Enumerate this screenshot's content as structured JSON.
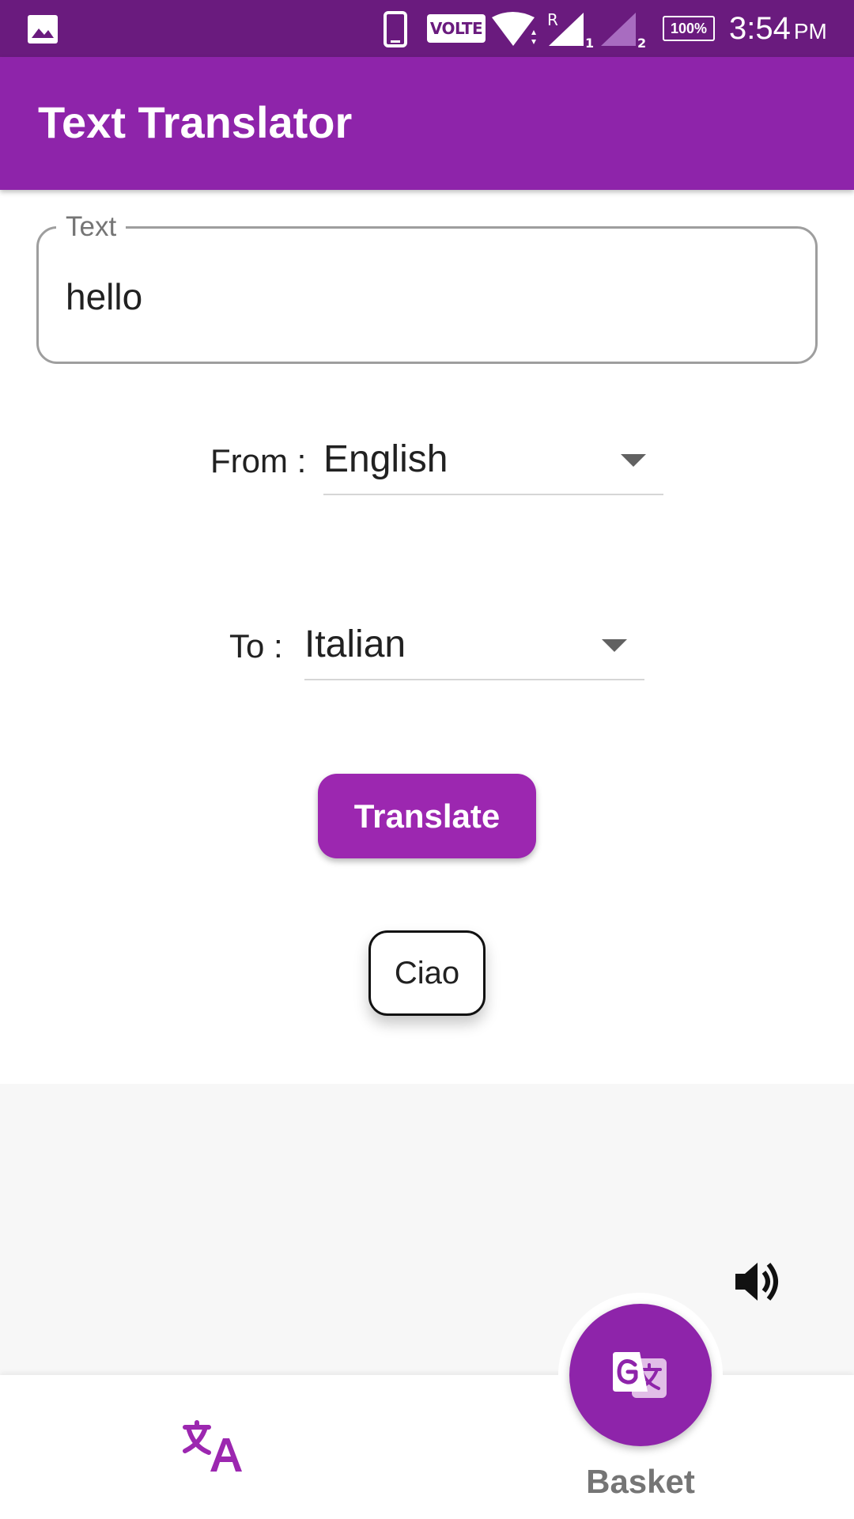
{
  "status_bar": {
    "volte": "VOLTE",
    "signal1_marker": "R",
    "signal1_sim": "1",
    "signal2_sim": "2",
    "battery": "100%",
    "time": "3:54",
    "ampm": "PM"
  },
  "app_bar": {
    "title": "Text Translator"
  },
  "text_field": {
    "label": "Text",
    "value": "hello"
  },
  "from": {
    "label": "From :",
    "selected": "English"
  },
  "to": {
    "label": "To :",
    "selected": "Italian"
  },
  "translate_button": {
    "label": "Translate"
  },
  "result": {
    "text": "Ciao"
  },
  "bottom_nav": {
    "basket_label": "Basket"
  },
  "colors": {
    "status_bar": "#6a1b7e",
    "app_bar": "#8e24aa",
    "accent": "#9c27b0"
  }
}
